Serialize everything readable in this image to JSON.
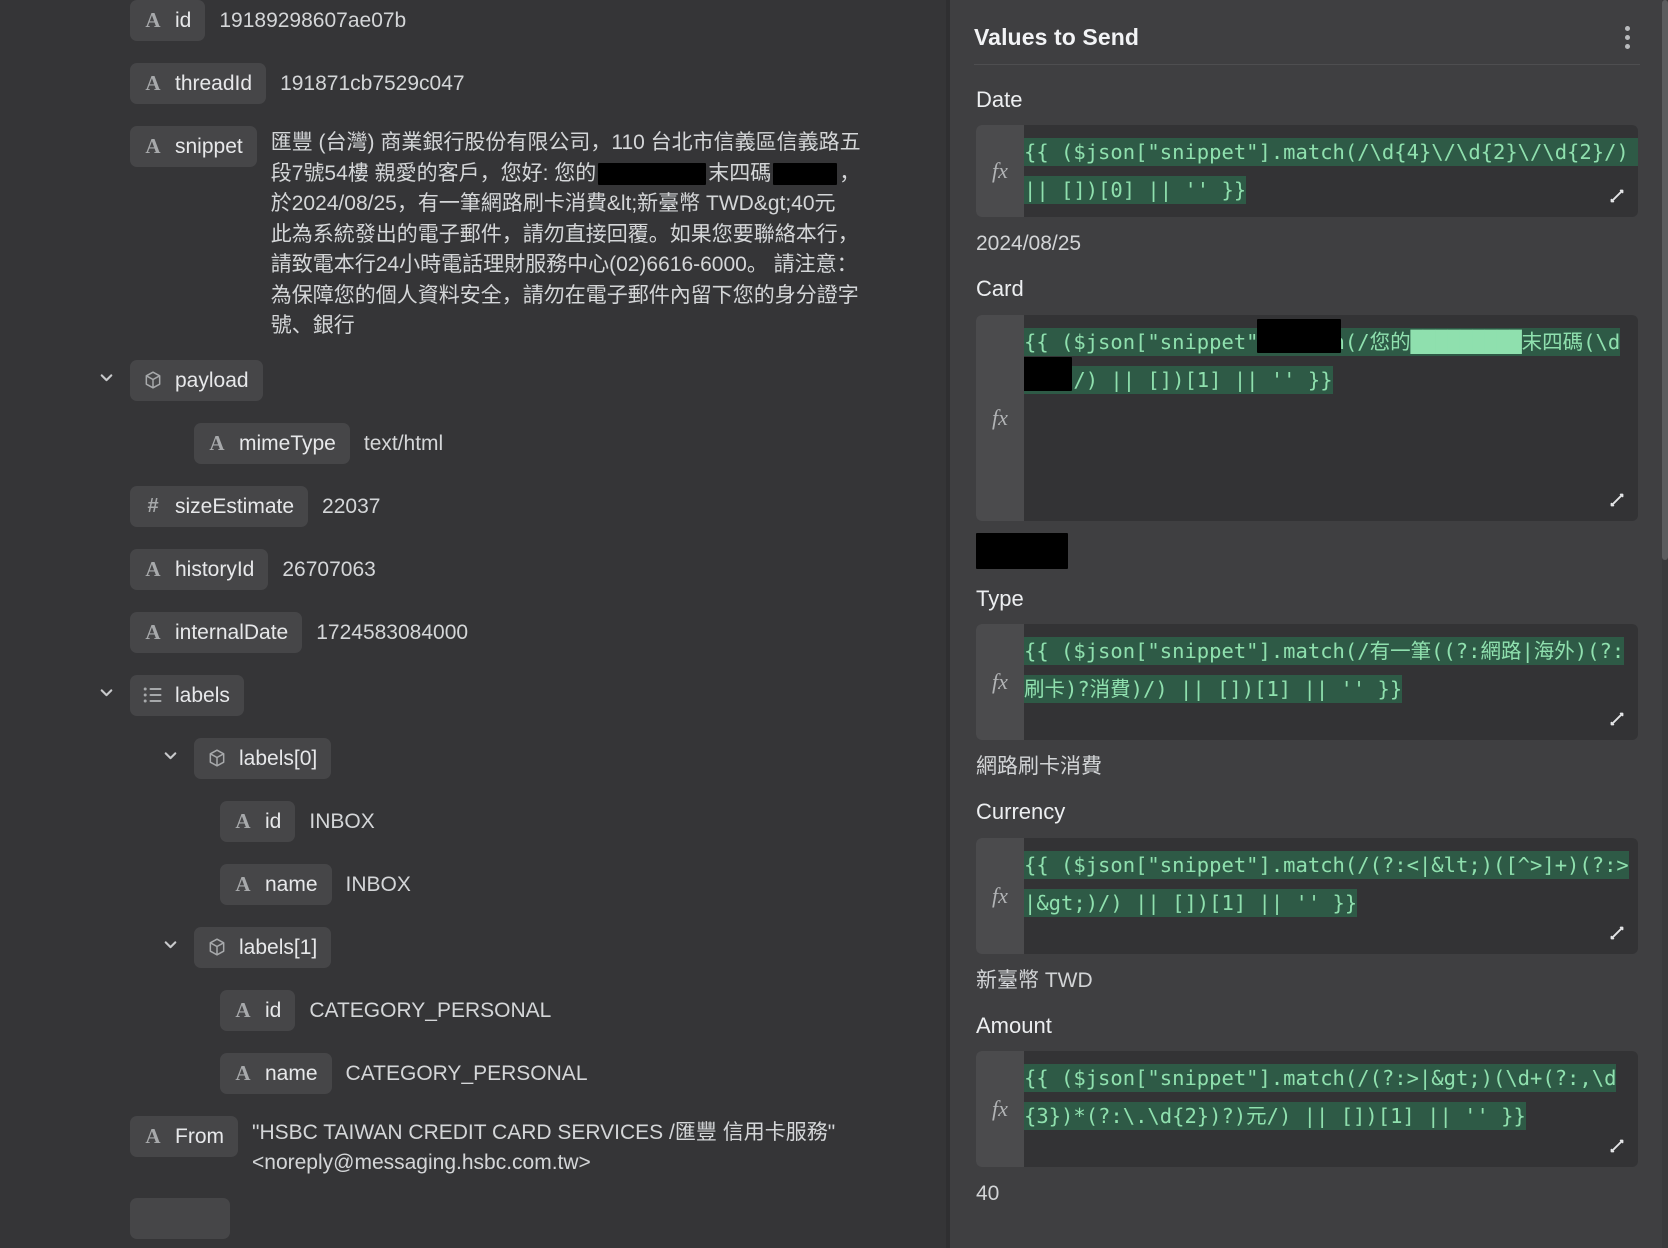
{
  "json_tree": {
    "nodes": [
      {
        "key": "id",
        "type_icon": "A",
        "value": "19189298607ae07b",
        "depth": 0,
        "expandable": false
      },
      {
        "key": "threadId",
        "type_icon": "A",
        "value": "191871cb7529c047",
        "depth": 0,
        "expandable": false
      },
      {
        "key": "snippet",
        "type_icon": "A",
        "value": "匯豐 (台灣) 商業銀行股份有限公司，110 台北市信義區信義路五段7號54樓 親愛的客戶，您好: 您的",
        "value_tail_1": "末四碼",
        "value_tail_2": "，於2024/08/25，有一筆網路刷卡消費&lt;新臺幣 TWD&gt;40元 此為系統發出的電子郵件，請勿直接回覆。如果您要聯絡本行，請致電本行24小時電話理財服務中心(02)6616-6000。 請注意：為保障您的個人資料安全，請勿在電子郵件內留下您的身分證字號、銀行",
        "depth": 0,
        "expandable": false
      },
      {
        "key": "payload",
        "type_icon": "box",
        "value": "",
        "depth": 0,
        "expandable": true,
        "expanded": true
      },
      {
        "key": "mimeType",
        "type_icon": "A",
        "value": "text/html",
        "depth": 1,
        "expandable": false
      },
      {
        "key": "sizeEstimate",
        "type_icon": "#",
        "value": "22037",
        "depth": 0,
        "expandable": false
      },
      {
        "key": "historyId",
        "type_icon": "A",
        "value": "26707063",
        "depth": 0,
        "expandable": false
      },
      {
        "key": "internalDate",
        "type_icon": "A",
        "value": "1724583084000",
        "depth": 0,
        "expandable": false
      },
      {
        "key": "labels",
        "type_icon": "list",
        "value": "",
        "depth": 0,
        "expandable": true,
        "expanded": true
      },
      {
        "key": "labels[0]",
        "type_icon": "box",
        "value": "",
        "depth": 1,
        "expandable": true,
        "expanded": true
      },
      {
        "key": "id",
        "type_icon": "A",
        "value": "INBOX",
        "depth": 2,
        "expandable": false
      },
      {
        "key": "name",
        "type_icon": "A",
        "value": "INBOX",
        "depth": 2,
        "expandable": false
      },
      {
        "key": "labels[1]",
        "type_icon": "box",
        "value": "",
        "depth": 1,
        "expandable": true,
        "expanded": true
      },
      {
        "key": "id",
        "type_icon": "A",
        "value": "CATEGORY_PERSONAL",
        "depth": 2,
        "expandable": false
      },
      {
        "key": "name",
        "type_icon": "A",
        "value": "CATEGORY_PERSONAL",
        "depth": 2,
        "expandable": false
      },
      {
        "key": "From",
        "type_icon": "A",
        "value": "\"HSBC TAIWAN CREDIT CARD SERVICES /匯豐 信用卡服務\" <noreply@messaging.hsbc.com.tw>",
        "depth": 0,
        "expandable": false
      }
    ]
  },
  "values_panel": {
    "title": "Values to Send",
    "menu_icon": "kebab-menu-icon",
    "fields": [
      {
        "label": "Date",
        "expression": "{{ ($json[\"snippet\"].match(/\\d{4}\\/\\d{2}\\/\\d{2}/) || [])[0] || '' }}",
        "resolved": "2024/08/25",
        "redacted_resolved": false
      },
      {
        "label": "Card",
        "expression": "{{ ($json[\"snippet\"].match(/您的█████████末四碼(\\d{4})/) || [])[1] || '' }}",
        "resolved": "",
        "redacted_resolved": true
      },
      {
        "label": "Type",
        "expression": "{{ ($json[\"snippet\"].match(/有一筆((?:網路|海外)(?:刷卡)?消費)/) || [])[1] || '' }}",
        "resolved": "網路刷卡消費",
        "redacted_resolved": false
      },
      {
        "label": "Currency",
        "expression": "{{ ($json[\"snippet\"].match(/(?:<|&lt;)([^>]+)(?:>|&gt;)/) || [])[1] || '' }}",
        "resolved": "新臺幣 TWD",
        "redacted_resolved": false
      },
      {
        "label": "Amount",
        "expression": "{{ ($json[\"snippet\"].match(/(?:>|&gt;)(\\d+(?:,\\d{3})*(?:\\.\\d{2})?)元/) || [])[1] || '' }}",
        "resolved": "40",
        "redacted_resolved": false
      }
    ],
    "expand_icon": "expand-editor-icon",
    "fx_label": "fx"
  },
  "colors": {
    "panel_left_bg": "#353537",
    "panel_right_bg": "#3f3f41",
    "chip_bg": "#464648",
    "expr_bg": "#333335",
    "expr_highlight": "#2e5a46",
    "expr_text": "#8fe0ae",
    "text_primary": "#e7e8ea",
    "text_secondary": "#d2d4d6"
  }
}
